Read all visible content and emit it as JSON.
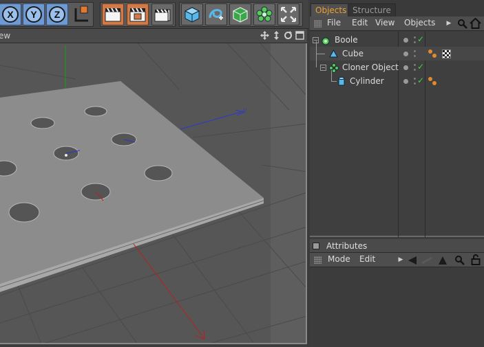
{
  "toolbar": {
    "axis_x": "X",
    "axis_y": "Y",
    "axis_z": "Z"
  },
  "viewport": {
    "title": "ew"
  },
  "objects_panel": {
    "tabs": [
      "Objects",
      "Structure"
    ],
    "menu": [
      "File",
      "Edit",
      "View",
      "Objects"
    ],
    "items": [
      {
        "label": "Boole"
      },
      {
        "label": "Cube"
      },
      {
        "label": "Cloner Object"
      },
      {
        "label": "Cylinder"
      }
    ]
  },
  "attributes_panel": {
    "title": "Attributes",
    "menu": [
      "Mode",
      "Edit"
    ]
  },
  "colors": {
    "accent_tab": "#f0a030",
    "axis_buttons": "#6e9ad1",
    "render_buttons": "#d07a4a",
    "visible_check": "#4ad04a"
  }
}
